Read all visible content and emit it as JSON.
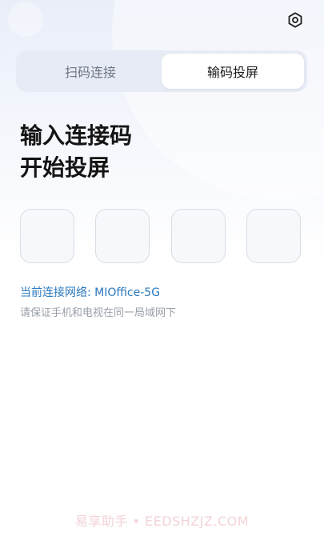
{
  "header": {
    "settings_icon": "gear-icon"
  },
  "tabs": [
    {
      "label": "扫码连接",
      "active": false
    },
    {
      "label": "输码投屏",
      "active": true
    }
  ],
  "main": {
    "heading_line1": "输入连接码",
    "heading_line2": "开始投屏",
    "code_inputs": [
      "",
      "",
      "",
      ""
    ],
    "network_label": "当前连接网络: MIOffice-5G",
    "hint": "请保证手机和电视在同一局域网下"
  },
  "watermark": "易享助手 • EEDSHZJZ.COM",
  "colors": {
    "accent": "#2a78bd",
    "tab_track": "#e6ebf5",
    "code_box_border": "#d9dde6",
    "hint_text": "#9aa0a9"
  }
}
